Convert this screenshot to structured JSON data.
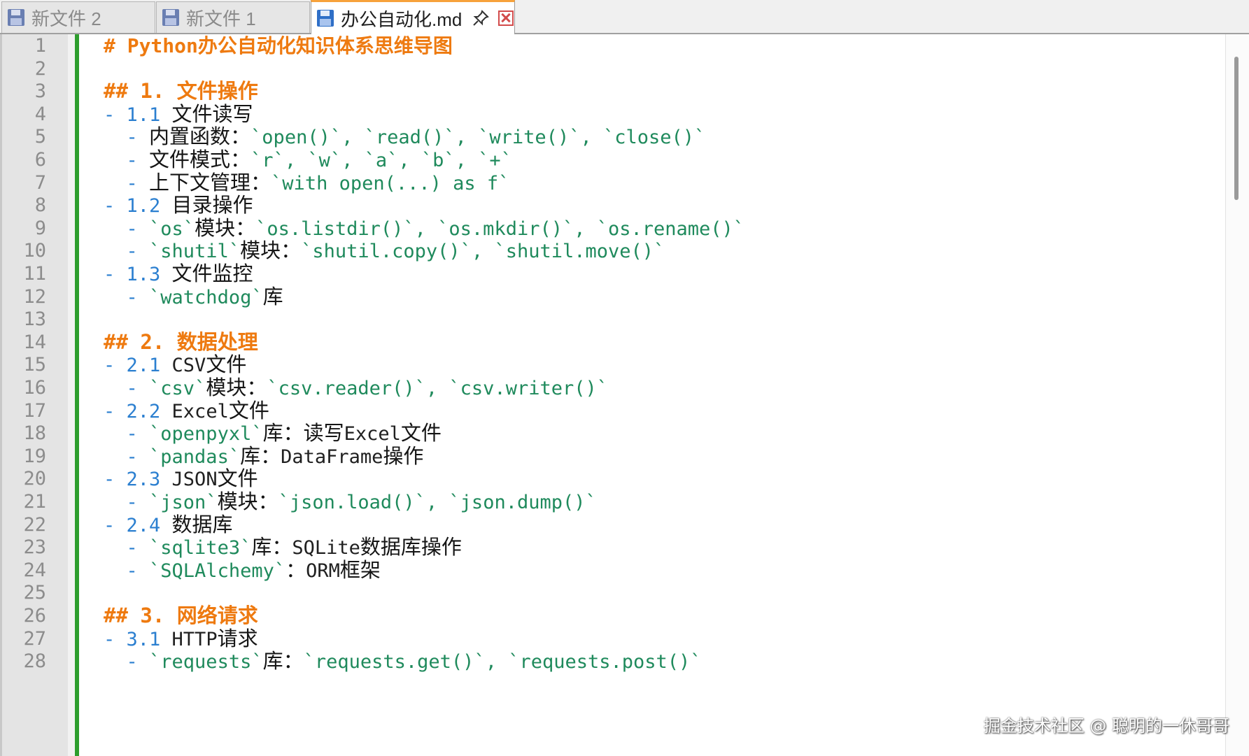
{
  "tabs": [
    {
      "label": "新文件 2",
      "active": false
    },
    {
      "label": "新文件 1",
      "active": false
    },
    {
      "label": "办公自动化.md",
      "active": true
    }
  ],
  "icons": {
    "file": "floppy-disk-icon",
    "pin": "pin-icon",
    "close": "close-icon"
  },
  "colors": {
    "heading": "#ee7a10",
    "bullet": "#2b7fd0",
    "inline_code": "#1f8a5c",
    "change_bar": "#2e9e2e",
    "active_tab_accent": "#f7a23b"
  },
  "lines": [
    [
      {
        "c": "h1",
        "t": "# Python办公自动化知识体系思维导图"
      }
    ],
    [],
    [
      {
        "c": "h2",
        "t": "## 1. 文件操作"
      }
    ],
    [
      {
        "c": "bullet",
        "t": "- "
      },
      {
        "c": "num",
        "t": "1.1 "
      },
      {
        "c": "cjk",
        "t": "文件读写"
      }
    ],
    [
      {
        "c": "txt",
        "t": "  "
      },
      {
        "c": "bullet",
        "t": "- "
      },
      {
        "c": "cjk",
        "t": "内置函数："
      },
      {
        "c": "inline",
        "t": "`open()`, `read()`, `write()`, `close()`"
      }
    ],
    [
      {
        "c": "txt",
        "t": "  "
      },
      {
        "c": "bullet",
        "t": "- "
      },
      {
        "c": "cjk",
        "t": "文件模式："
      },
      {
        "c": "inline",
        "t": "`r`, `w`, `a`, `b`, `+`"
      }
    ],
    [
      {
        "c": "txt",
        "t": "  "
      },
      {
        "c": "bullet",
        "t": "- "
      },
      {
        "c": "cjk",
        "t": "上下文管理："
      },
      {
        "c": "inline",
        "t": "`with open(...) as f`"
      }
    ],
    [
      {
        "c": "bullet",
        "t": "- "
      },
      {
        "c": "num",
        "t": "1.2 "
      },
      {
        "c": "cjk",
        "t": "目录操作"
      }
    ],
    [
      {
        "c": "txt",
        "t": "  "
      },
      {
        "c": "bullet",
        "t": "- "
      },
      {
        "c": "inline",
        "t": "`os`"
      },
      {
        "c": "cjk",
        "t": "模块："
      },
      {
        "c": "inline",
        "t": "`os.listdir()`, `os.mkdir()`, `os.rename()`"
      }
    ],
    [
      {
        "c": "txt",
        "t": "  "
      },
      {
        "c": "bullet",
        "t": "- "
      },
      {
        "c": "inline",
        "t": "`shutil`"
      },
      {
        "c": "cjk",
        "t": "模块："
      },
      {
        "c": "inline",
        "t": "`shutil.copy()`, `shutil.move()`"
      }
    ],
    [
      {
        "c": "bullet",
        "t": "- "
      },
      {
        "c": "num",
        "t": "1.3 "
      },
      {
        "c": "cjk",
        "t": "文件监控"
      }
    ],
    [
      {
        "c": "txt",
        "t": "  "
      },
      {
        "c": "bullet",
        "t": "- "
      },
      {
        "c": "inline",
        "t": "`watchdog`"
      },
      {
        "c": "cjk",
        "t": "库"
      }
    ],
    [],
    [
      {
        "c": "h2",
        "t": "## 2. 数据处理"
      }
    ],
    [
      {
        "c": "bullet",
        "t": "- "
      },
      {
        "c": "num",
        "t": "2.1 "
      },
      {
        "c": "txt",
        "t": "CSV"
      },
      {
        "c": "cjk",
        "t": "文件"
      }
    ],
    [
      {
        "c": "txt",
        "t": "  "
      },
      {
        "c": "bullet",
        "t": "- "
      },
      {
        "c": "inline",
        "t": "`csv`"
      },
      {
        "c": "cjk",
        "t": "模块："
      },
      {
        "c": "inline",
        "t": "`csv.reader()`, `csv.writer()`"
      }
    ],
    [
      {
        "c": "bullet",
        "t": "- "
      },
      {
        "c": "num",
        "t": "2.2 "
      },
      {
        "c": "txt",
        "t": "Excel"
      },
      {
        "c": "cjk",
        "t": "文件"
      }
    ],
    [
      {
        "c": "txt",
        "t": "  "
      },
      {
        "c": "bullet",
        "t": "- "
      },
      {
        "c": "inline",
        "t": "`openpyxl`"
      },
      {
        "c": "cjk",
        "t": "库：读写"
      },
      {
        "c": "txt",
        "t": "Excel"
      },
      {
        "c": "cjk",
        "t": "文件"
      }
    ],
    [
      {
        "c": "txt",
        "t": "  "
      },
      {
        "c": "bullet",
        "t": "- "
      },
      {
        "c": "inline",
        "t": "`pandas`"
      },
      {
        "c": "cjk",
        "t": "库："
      },
      {
        "c": "txt",
        "t": "DataFrame"
      },
      {
        "c": "cjk",
        "t": "操作"
      }
    ],
    [
      {
        "c": "bullet",
        "t": "- "
      },
      {
        "c": "num",
        "t": "2.3 "
      },
      {
        "c": "txt",
        "t": "JSON"
      },
      {
        "c": "cjk",
        "t": "文件"
      }
    ],
    [
      {
        "c": "txt",
        "t": "  "
      },
      {
        "c": "bullet",
        "t": "- "
      },
      {
        "c": "inline",
        "t": "`json`"
      },
      {
        "c": "cjk",
        "t": "模块："
      },
      {
        "c": "inline",
        "t": "`json.load()`, `json.dump()`"
      }
    ],
    [
      {
        "c": "bullet",
        "t": "- "
      },
      {
        "c": "num",
        "t": "2.4 "
      },
      {
        "c": "cjk",
        "t": "数据库"
      }
    ],
    [
      {
        "c": "txt",
        "t": "  "
      },
      {
        "c": "bullet",
        "t": "- "
      },
      {
        "c": "inline",
        "t": "`sqlite3`"
      },
      {
        "c": "cjk",
        "t": "库："
      },
      {
        "c": "txt",
        "t": "SQLite"
      },
      {
        "c": "cjk",
        "t": "数据库操作"
      }
    ],
    [
      {
        "c": "txt",
        "t": "  "
      },
      {
        "c": "bullet",
        "t": "- "
      },
      {
        "c": "inline",
        "t": "`SQLAlchemy`"
      },
      {
        "c": "cjk",
        "t": "："
      },
      {
        "c": "txt",
        "t": "ORM"
      },
      {
        "c": "cjk",
        "t": "框架"
      }
    ],
    [],
    [
      {
        "c": "h2",
        "t": "## 3. 网络请求"
      }
    ],
    [
      {
        "c": "bullet",
        "t": "- "
      },
      {
        "c": "num",
        "t": "3.1 "
      },
      {
        "c": "txt",
        "t": "HTTP"
      },
      {
        "c": "cjk",
        "t": "请求"
      }
    ],
    [
      {
        "c": "txt",
        "t": "  "
      },
      {
        "c": "bullet",
        "t": "- "
      },
      {
        "c": "inline",
        "t": "`requests`"
      },
      {
        "c": "cjk",
        "t": "库："
      },
      {
        "c": "inline",
        "t": "`requests.get()`, `requests.post()`"
      }
    ]
  ],
  "watermark": "掘金技术社区 @ 聪明的一休哥哥"
}
